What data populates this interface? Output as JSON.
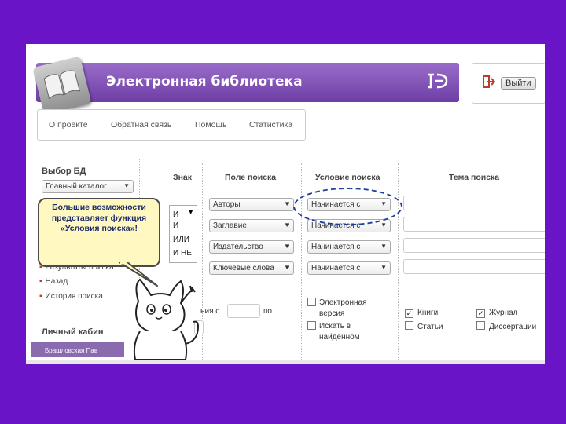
{
  "header": {
    "title": "Электронная библиотека",
    "brandmark": "Ͽ"
  },
  "exit": {
    "label": "Выйти"
  },
  "nav": {
    "items": [
      "О проекте",
      "Обратная связь",
      "Помощь",
      "Статистика"
    ]
  },
  "sidebar": {
    "db_title": "Выбор БД",
    "db_select": "Главный каталог",
    "menu": [
      "Результаты поиска",
      "Назад",
      "История поиска"
    ],
    "cabinet_title": "Личный кабин",
    "user_bar": "Брашловская Пав"
  },
  "search": {
    "headers": {
      "sign": "Знак",
      "field": "Поле поиска",
      "condition": "Условие поиска",
      "topic": "Тема поиска"
    },
    "sign_options": [
      "И",
      "И",
      "ИЛИ",
      "И НЕ"
    ],
    "fields": [
      "Авторы",
      "Заглавие",
      "Издательство",
      "Ключевые слова"
    ],
    "conditions": [
      "Начинается с",
      "Начинается с",
      "Начинается с",
      "Начинается с"
    ],
    "year": {
      "label": "ния с",
      "to": "по"
    },
    "electronic_version": "Электронная версия",
    "search_in_found": "Искать в найденном",
    "types": [
      {
        "label": "Книги",
        "checked": true
      },
      {
        "label": "Журнал",
        "checked": true
      },
      {
        "label": "Статьи",
        "checked": false
      },
      {
        "label": "Диссертации",
        "checked": false
      }
    ]
  },
  "callout": {
    "text": "Большие возможности представляет функция «Условия поиска»!"
  },
  "colors": {
    "background": "#6a14c8",
    "header": "#7d4fb4",
    "highlight": "#1d3f9a",
    "callout": "#fff8c0"
  }
}
